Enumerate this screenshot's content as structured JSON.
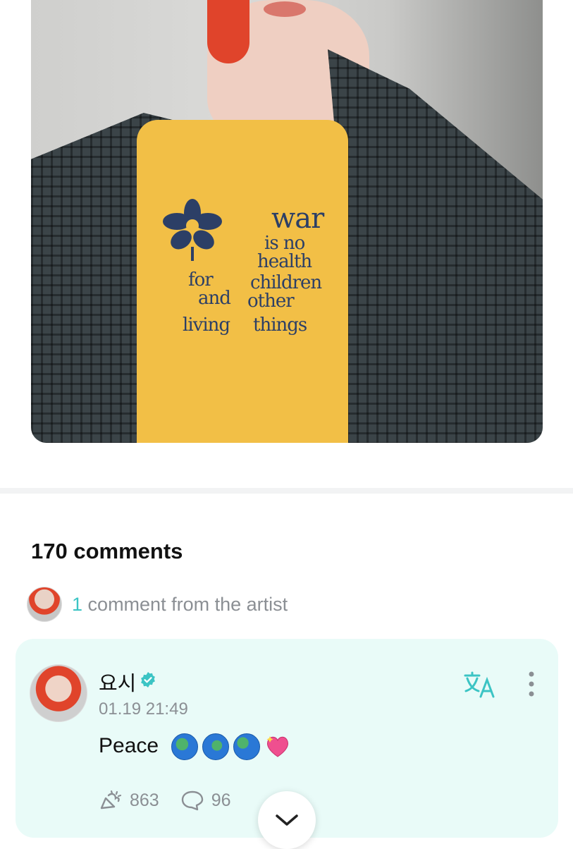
{
  "post": {
    "shirt_print": {
      "line1": "war",
      "line2": "is no",
      "line3": "health",
      "line4a": "for",
      "line4b": "children",
      "line5a": "and",
      "line5b": "other",
      "line6a": "living",
      "line6b": "things"
    }
  },
  "comments": {
    "count_label": "170 comments",
    "artist_summary": {
      "count": "1",
      "label": "comment from the artist"
    },
    "artist_comment": {
      "author": "요시",
      "timestamp": "01.19 21:49",
      "text": "Peace",
      "emojis": [
        "globe-europe-africa",
        "globe-europe-africa",
        "globe-asia-australia",
        "sparkling-heart"
      ],
      "likes": "863",
      "replies": "96"
    }
  },
  "colors": {
    "accent": "#3bc4c4",
    "card_bg": "#e9fbf8",
    "muted_text": "#8b8f94"
  }
}
